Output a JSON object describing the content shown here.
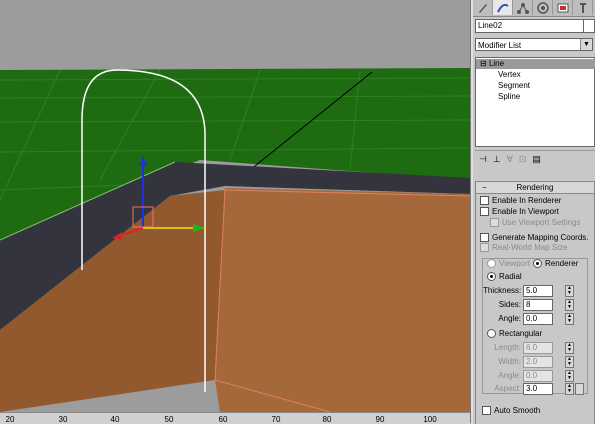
{
  "ruler": {
    "ticks": [
      "20",
      "30",
      "40",
      "50",
      "60",
      "70",
      "80",
      "90",
      "100"
    ]
  },
  "panel": {
    "tabs": [
      "create-icon",
      "modify-icon",
      "hierarchy-icon",
      "motion-icon",
      "display-icon",
      "utilities-icon"
    ],
    "object_name": "Line02",
    "modifier_list": "Modifier List",
    "stack": [
      {
        "label": "Line",
        "level": 0,
        "selected": true
      },
      {
        "label": "Vertex",
        "level": 1
      },
      {
        "label": "Segment",
        "level": 1
      },
      {
        "label": "Spline",
        "level": 1
      }
    ],
    "rendering": {
      "title": "Rendering",
      "enable_renderer": "Enable In Renderer",
      "enable_viewport": "Enable In Viewport",
      "use_viewport_settings": "Use Viewport Settings",
      "generate_mapping": "Generate Mapping Coords.",
      "real_world": "Real-World Map Size",
      "viewport": "Viewport",
      "renderer": "Renderer",
      "radial": "Radial",
      "thickness_label": "Thickness:",
      "thickness": "5.0",
      "sides_label": "Sides:",
      "sides": "8",
      "angle_label": "Angle:",
      "angle": "0.0",
      "rectangular": "Rectangular",
      "length_label": "Length:",
      "length": "6.0",
      "width_label": "Width:",
      "width": "2.0",
      "rect_angle_label": "Angle:",
      "rect_angle": "0.0",
      "aspect_label": "Aspect:",
      "aspect": "3.0",
      "auto_smooth": "Auto Smooth"
    }
  }
}
